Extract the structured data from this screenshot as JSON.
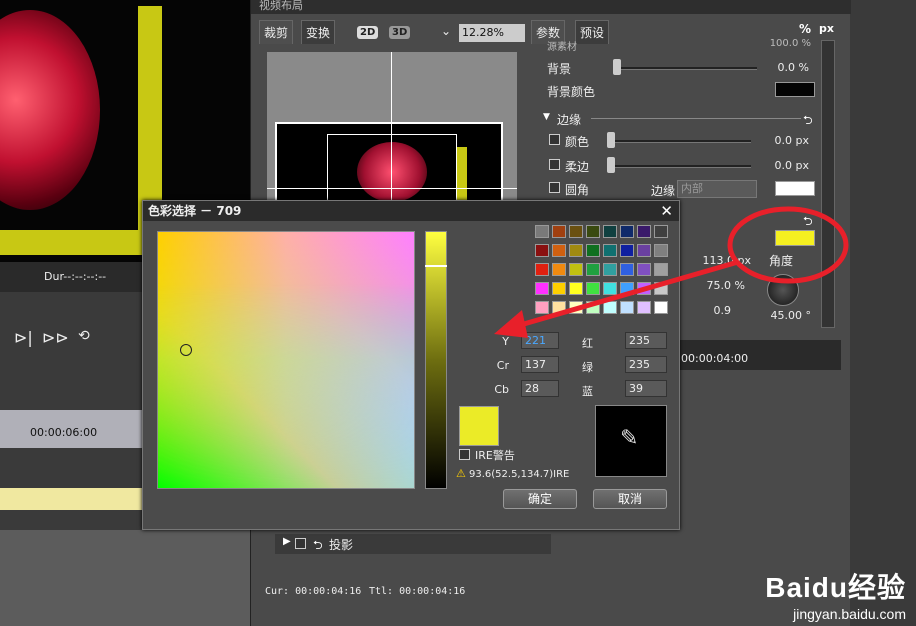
{
  "preview": {
    "dur_label": "Dur--:--:--:--"
  },
  "layout_dialog": {
    "title": "视频布局",
    "tabs": [
      "裁剪",
      "变换"
    ],
    "mode_2d": "2D",
    "mode_3d": "3D",
    "zoom": "12.28%",
    "right_tabs": [
      "参数",
      "预设"
    ],
    "unit_percent": "%",
    "unit_px": "px",
    "truncated_row": "源素材",
    "truncated_value": "100.0 %",
    "bg_label": "背景",
    "bg_value": "0.0 %",
    "bg_color_label": "背景颜色",
    "edge_section": "边缘",
    "edge_color_label": "颜色",
    "edge_color_value": "0.0 px",
    "soft_edge_label": "柔边",
    "soft_edge_value": "0.0 px",
    "round_label": "圆角",
    "edge_select_label": "边缘",
    "edge_select_value": "内部",
    "shadow_distance": "113.0 px",
    "angle_label": "角度",
    "opacity_value": "75.0 %",
    "softness_value": "0.9",
    "angle_value": "45.00 °",
    "shadow_label": "投影",
    "cur_time": "Cur: 00:00:04:16",
    "ttl_time": "Ttl: 00:00:04:16"
  },
  "timeline": {
    "tc_left": "00:00:06:00",
    "tc_right": "00:00:04:00"
  },
  "color_picker": {
    "title": "色彩选择 － 709",
    "fields": [
      {
        "label": "Y",
        "value": "221"
      },
      {
        "label": "Cr",
        "value": "137"
      },
      {
        "label": "Cb",
        "value": "28"
      },
      {
        "label": "红",
        "value": "235"
      },
      {
        "label": "绿",
        "value": "235"
      },
      {
        "label": "蓝",
        "value": "39"
      }
    ],
    "ire_label": "IRE警告",
    "ire_value": "93.6(52.5,134.7)IRE",
    "ok": "确定",
    "cancel": "取消",
    "selected_color": "#ebeb27",
    "swatches": [
      [
        "#7a7a7a",
        "#a04010",
        "#6a5010",
        "#3a4a10",
        "#104040",
        "#102a6a",
        "#3a1a6a",
        "#404040"
      ],
      [
        "#8a1010",
        "#d06010",
        "#a08a10",
        "#107020",
        "#107070",
        "#1020a0",
        "#6a40a0",
        "#808080"
      ],
      [
        "#e02010",
        "#f08a10",
        "#c0c010",
        "#20a040",
        "#30a0a0",
        "#3060e0",
        "#8050c0",
        "#a0a0a0"
      ],
      [
        "#ff30ff",
        "#ffd000",
        "#ffff20",
        "#40e040",
        "#40e0e0",
        "#40a0ff",
        "#c060ff",
        "#c8c8c8"
      ],
      [
        "#ffa0c0",
        "#ffe0a0",
        "#ffffc0",
        "#c0ffc0",
        "#c0ffff",
        "#c0e0ff",
        "#e0c0ff",
        "#ffffff"
      ]
    ]
  },
  "watermark": {
    "brand": "Baidu经验",
    "url": "jingyan.baidu.com"
  }
}
